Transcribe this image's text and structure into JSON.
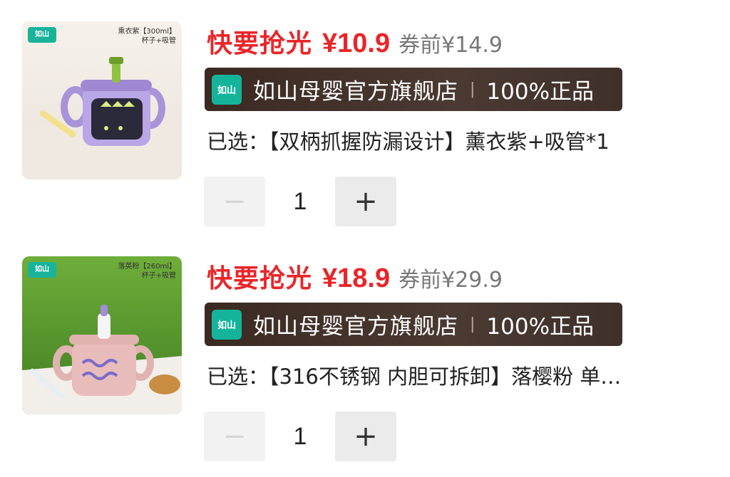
{
  "items": [
    {
      "thumb": {
        "brand": "如山",
        "caption_line1": "熏衣紫【300ml】",
        "caption_line2": "杯子+吸管"
      },
      "promo_tag": "快要抢光",
      "price": "¥10.9",
      "original_price": "券前¥14.9",
      "store": {
        "logo_text": "如山",
        "name": "如山母婴官方旗舰店",
        "separator": "|",
        "authentic": "100%正品"
      },
      "selected": "已选：【双柄抓握防漏设计】薰衣紫+吸管*1",
      "quantity": "1",
      "minus_label": "−",
      "plus_label": "+"
    },
    {
      "thumb": {
        "brand": "如山",
        "caption_line1": "落英粉【260ml】",
        "caption_line2": "杯子+吸管"
      },
      "promo_tag": "快要抢光",
      "price": "¥18.9",
      "original_price": "券前¥29.9",
      "store": {
        "logo_text": "如山",
        "name": "如山母婴官方旗舰店",
        "separator": "|",
        "authentic": "100%正品"
      },
      "selected": "已选：【316不锈钢 内胆可拆卸】落樱粉 单…",
      "quantity": "1",
      "minus_label": "−",
      "plus_label": "+"
    }
  ]
}
